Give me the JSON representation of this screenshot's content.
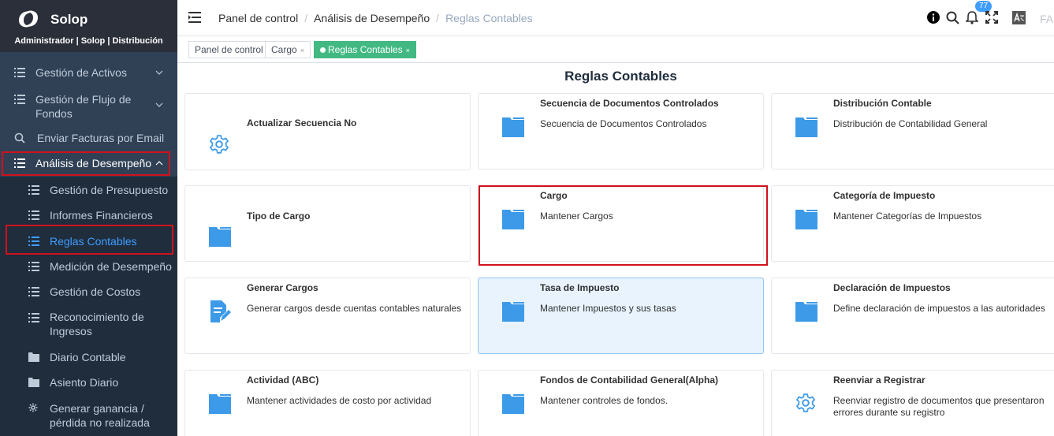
{
  "brand": {
    "name": "Solop",
    "role": "Administrador | Solop | Distribución"
  },
  "sidebar": {
    "items": [
      {
        "label": "Gestión de Activos"
      },
      {
        "label": "Gestión de Flujo de Fondos"
      },
      {
        "label": "Enviar Facturas por Email"
      },
      {
        "label": "Análisis de Desempeño"
      }
    ],
    "subitems": [
      {
        "label": "Gestión de Presupuesto"
      },
      {
        "label": "Informes Financieros"
      },
      {
        "label": "Reglas Contables"
      },
      {
        "label": "Medición de Desempeño"
      },
      {
        "label": "Gestión de Costos"
      },
      {
        "label": "Reconocimiento de Ingresos"
      },
      {
        "label": "Diario Contable"
      },
      {
        "label": "Asiento Diario"
      },
      {
        "label": "Generar ganancia / pérdida no realizada"
      }
    ]
  },
  "navbar": {
    "breadcrumbs": [
      "Panel de control",
      "Análisis de Desempeño",
      "Reglas Contables"
    ],
    "notification_count": "77",
    "user_abbr": "FA"
  },
  "tags": [
    {
      "label": "Panel de control"
    },
    {
      "label": "Cargo",
      "close": "×"
    },
    {
      "label": "Reglas Contables",
      "close": "×"
    }
  ],
  "page": {
    "title": "Reglas Contables"
  },
  "cards": [
    {
      "title": "Actualizar Secuencia No",
      "desc": "",
      "icon": "gear-icon"
    },
    {
      "title": "Secuencia de Documentos Controlados",
      "desc": "Secuencia de Documentos Controlados",
      "icon": "folder-icon"
    },
    {
      "title": "Distribución Contable",
      "desc": "Distribución de Contabilidad General",
      "icon": "folder-icon"
    },
    {
      "title": "Tipo de Cargo",
      "desc": "",
      "icon": "folder-icon"
    },
    {
      "title": "Cargo",
      "desc": "Mantener Cargos",
      "icon": "folder-icon"
    },
    {
      "title": "Categoría de Impuesto",
      "desc": "Mantener Categorías de Impuestos",
      "icon": "folder-icon"
    },
    {
      "title": "Generar Cargos",
      "desc": "Generar cargos desde cuentas contables naturales",
      "icon": "document-edit-icon"
    },
    {
      "title": "Tasa de Impuesto",
      "desc": "Mantener Impuestos y sus tasas",
      "icon": "folder-icon"
    },
    {
      "title": "Declaración de Impuestos",
      "desc": "Define declaración de impuestos a las autoridades",
      "icon": "folder-icon"
    },
    {
      "title": "Actividad (ABC)",
      "desc": "Mantener actividades de costo por actividad",
      "icon": "folder-icon"
    },
    {
      "title": "Fondos de Contabilidad General(Alpha)",
      "desc": "Mantener controles de fondos.",
      "icon": "folder-icon"
    },
    {
      "title": "Reenviar a Registrar",
      "desc": "Reenviar registro de documentos que presentaron errores durante su registro",
      "icon": "gear-icon"
    }
  ],
  "colors": {
    "accent": "#409eff",
    "sidebar_bg": "#304156",
    "tag_active": "#42b983",
    "highlight_red": "#d0121b"
  }
}
